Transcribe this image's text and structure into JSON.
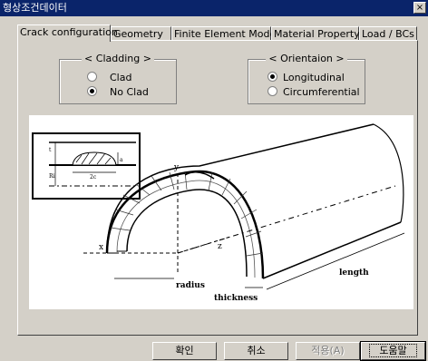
{
  "window": {
    "title": "형상조건데이터",
    "close_glyph": "×"
  },
  "tabs": [
    {
      "label": "Crack configuration",
      "active": true
    },
    {
      "label": "Geometry"
    },
    {
      "label": "Finite Element Model"
    },
    {
      "label": "Material Property"
    },
    {
      "label": "Load / BCs"
    }
  ],
  "cladding": {
    "legend": "< Cladding >",
    "options": [
      {
        "label": "Clad",
        "selected": false
      },
      {
        "label": "No Clad",
        "selected": true
      }
    ]
  },
  "orientation": {
    "legend": "< Orientaion >",
    "options": [
      {
        "label": "Longitudinal",
        "selected": true
      },
      {
        "label": "Circumferential",
        "selected": false
      }
    ]
  },
  "diagram": {
    "labels": {
      "x": "x",
      "y": "y",
      "z": "z",
      "radius": "radius",
      "thickness": "thickness",
      "length": "length",
      "a": "a",
      "two_c": "2c",
      "t": "t",
      "ri": "Ri"
    }
  },
  "buttons": {
    "ok": "확인",
    "cancel": "취소",
    "apply": "적용(A)",
    "help": "도움말"
  }
}
